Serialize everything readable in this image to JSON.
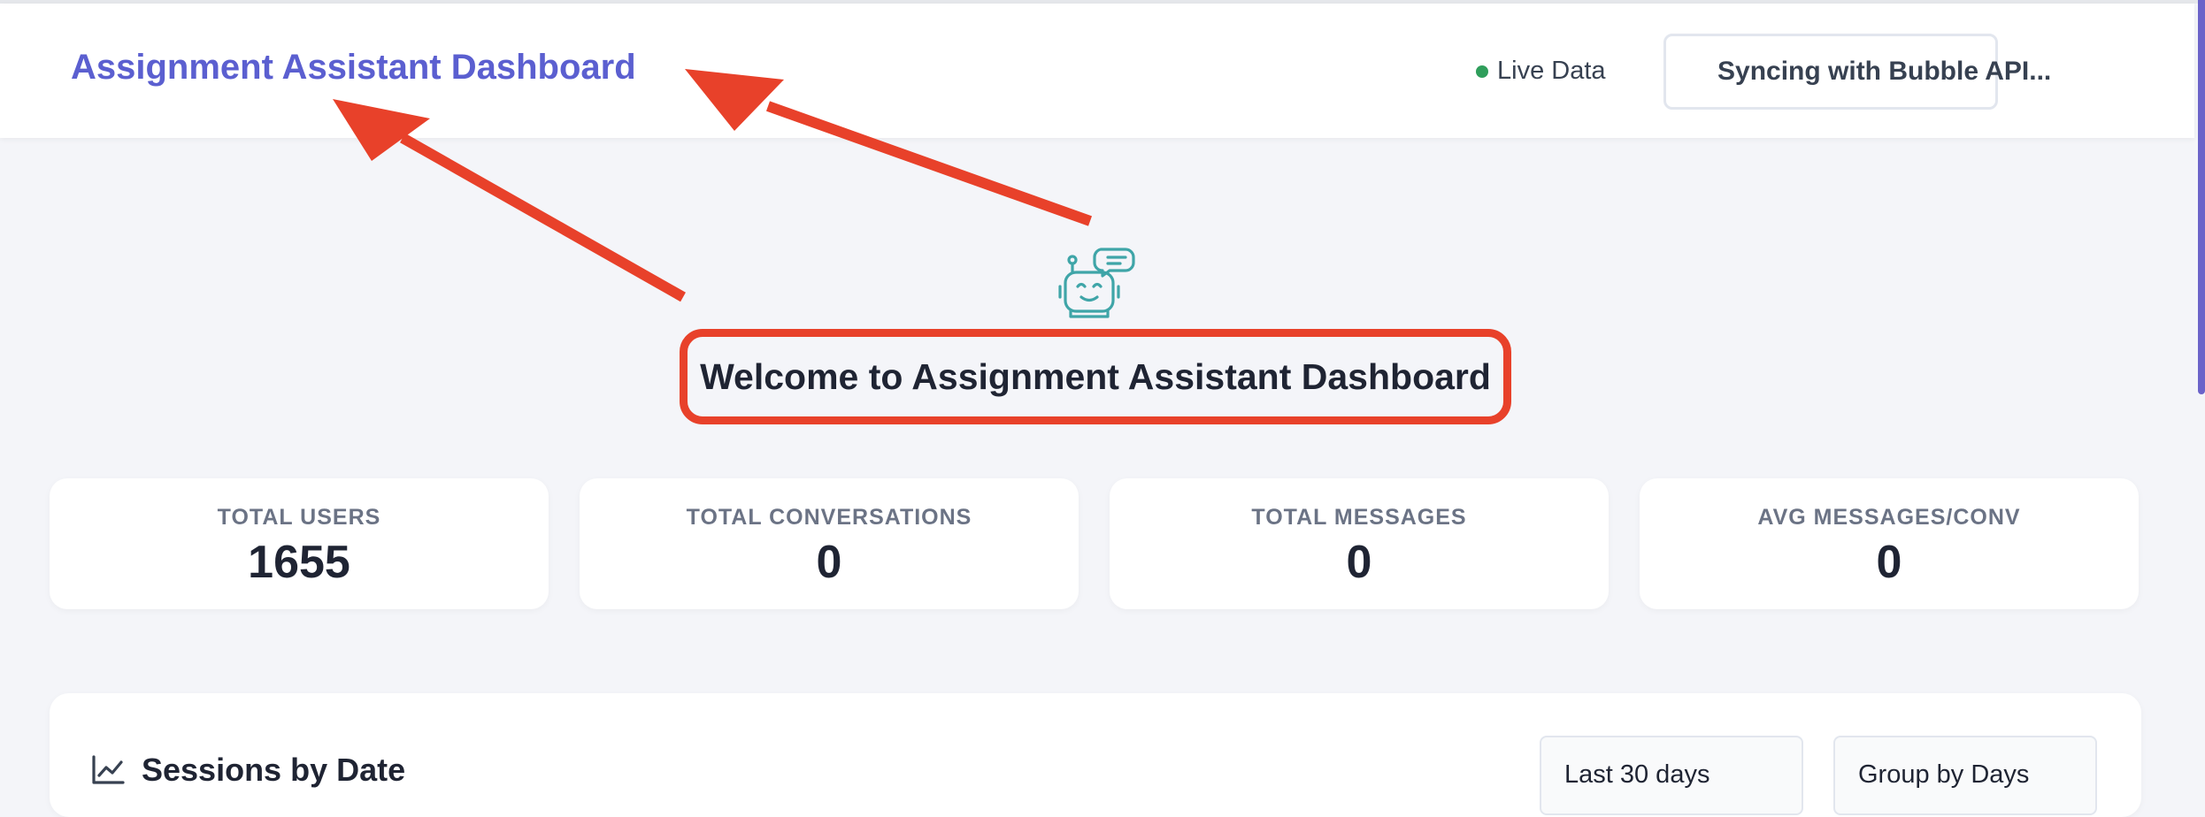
{
  "header": {
    "title": "Assignment Assistant Dashboard",
    "live_label": "Live Data",
    "sync_label": "Syncing with Bubble API..."
  },
  "hero": {
    "icon": "robot-chat-icon",
    "welcome": "Welcome to Assignment Assistant Dashboard"
  },
  "stats": [
    {
      "label": "TOTAL USERS",
      "value": "1655"
    },
    {
      "label": "TOTAL CONVERSATIONS",
      "value": "0"
    },
    {
      "label": "TOTAL MESSAGES",
      "value": "0"
    },
    {
      "label": "AVG MESSAGES/CONV",
      "value": "0"
    }
  ],
  "sessions": {
    "title": "Sessions by Date",
    "range_select": "Last 30 days",
    "group_select": "Group by Days"
  },
  "colors": {
    "accent": "#5b5fd0",
    "live": "#2f9e5b",
    "annotation": "#e8412a",
    "robot": "#3fa5a8"
  }
}
